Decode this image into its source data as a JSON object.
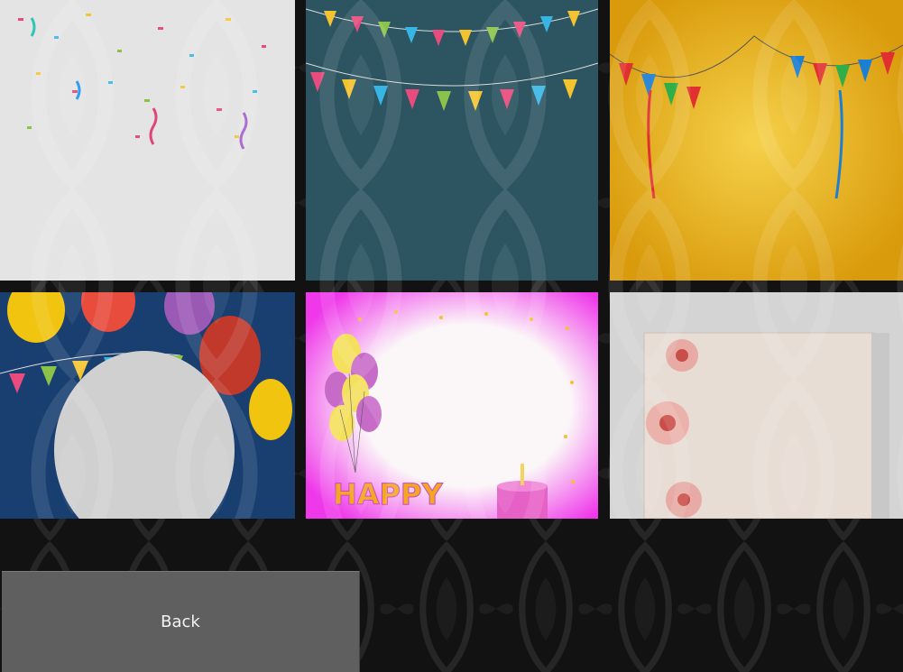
{
  "tiles": [
    {
      "theme": "white-confetti",
      "bg": "#d8d8d8"
    },
    {
      "theme": "teal-bunting",
      "bg": "#2f5a66"
    },
    {
      "theme": "yellow-bunting",
      "bg": "#e3ad14"
    },
    {
      "theme": "blue-balloons",
      "bg": "#1d3f72"
    },
    {
      "theme": "pink-happy-frame",
      "bg": "#ef38ea",
      "text": "HAPPY"
    },
    {
      "theme": "floral-card",
      "bg": "#d4d4d4"
    }
  ],
  "back_button": {
    "label": "Back"
  },
  "colors": {
    "page_background": "#111111",
    "button_background": "#5f5f5f",
    "button_text": "#f2f2f2"
  }
}
